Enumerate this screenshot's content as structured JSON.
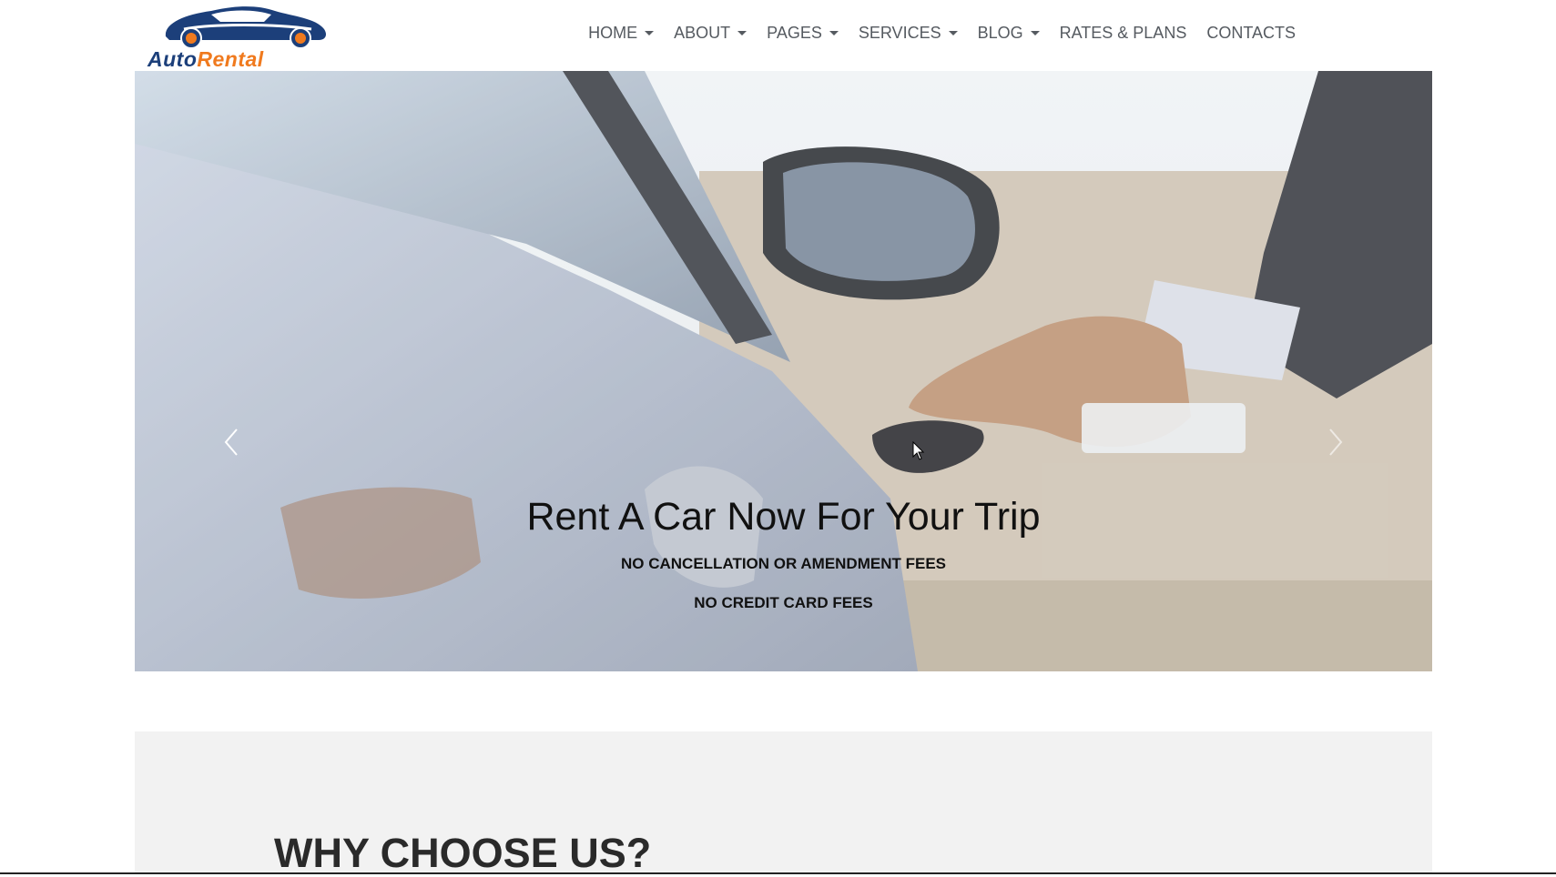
{
  "brand": {
    "logo_auto": "Auto",
    "logo_rental": "Rental",
    "colors": {
      "navy": "#1c3f7a",
      "orange": "#f07a1e"
    }
  },
  "nav": {
    "items": [
      {
        "label": "HOME",
        "dropdown": true
      },
      {
        "label": "ABOUT",
        "dropdown": true
      },
      {
        "label": "PAGES",
        "dropdown": true
      },
      {
        "label": "SERVICES",
        "dropdown": true
      },
      {
        "label": "BLOG",
        "dropdown": true
      },
      {
        "label": "RATES & PLANS",
        "dropdown": false
      },
      {
        "label": "CONTACTS",
        "dropdown": false
      }
    ]
  },
  "hero": {
    "title": "Rent A Car Now For Your Trip",
    "subtitle_1": "NO CANCELLATION OR AMENDMENT FEES",
    "subtitle_2": "NO CREDIT CARD FEES",
    "prev_icon": "chevron-left-icon",
    "next_icon": "chevron-right-icon"
  },
  "why": {
    "title": "WHY CHOOSE US?"
  }
}
